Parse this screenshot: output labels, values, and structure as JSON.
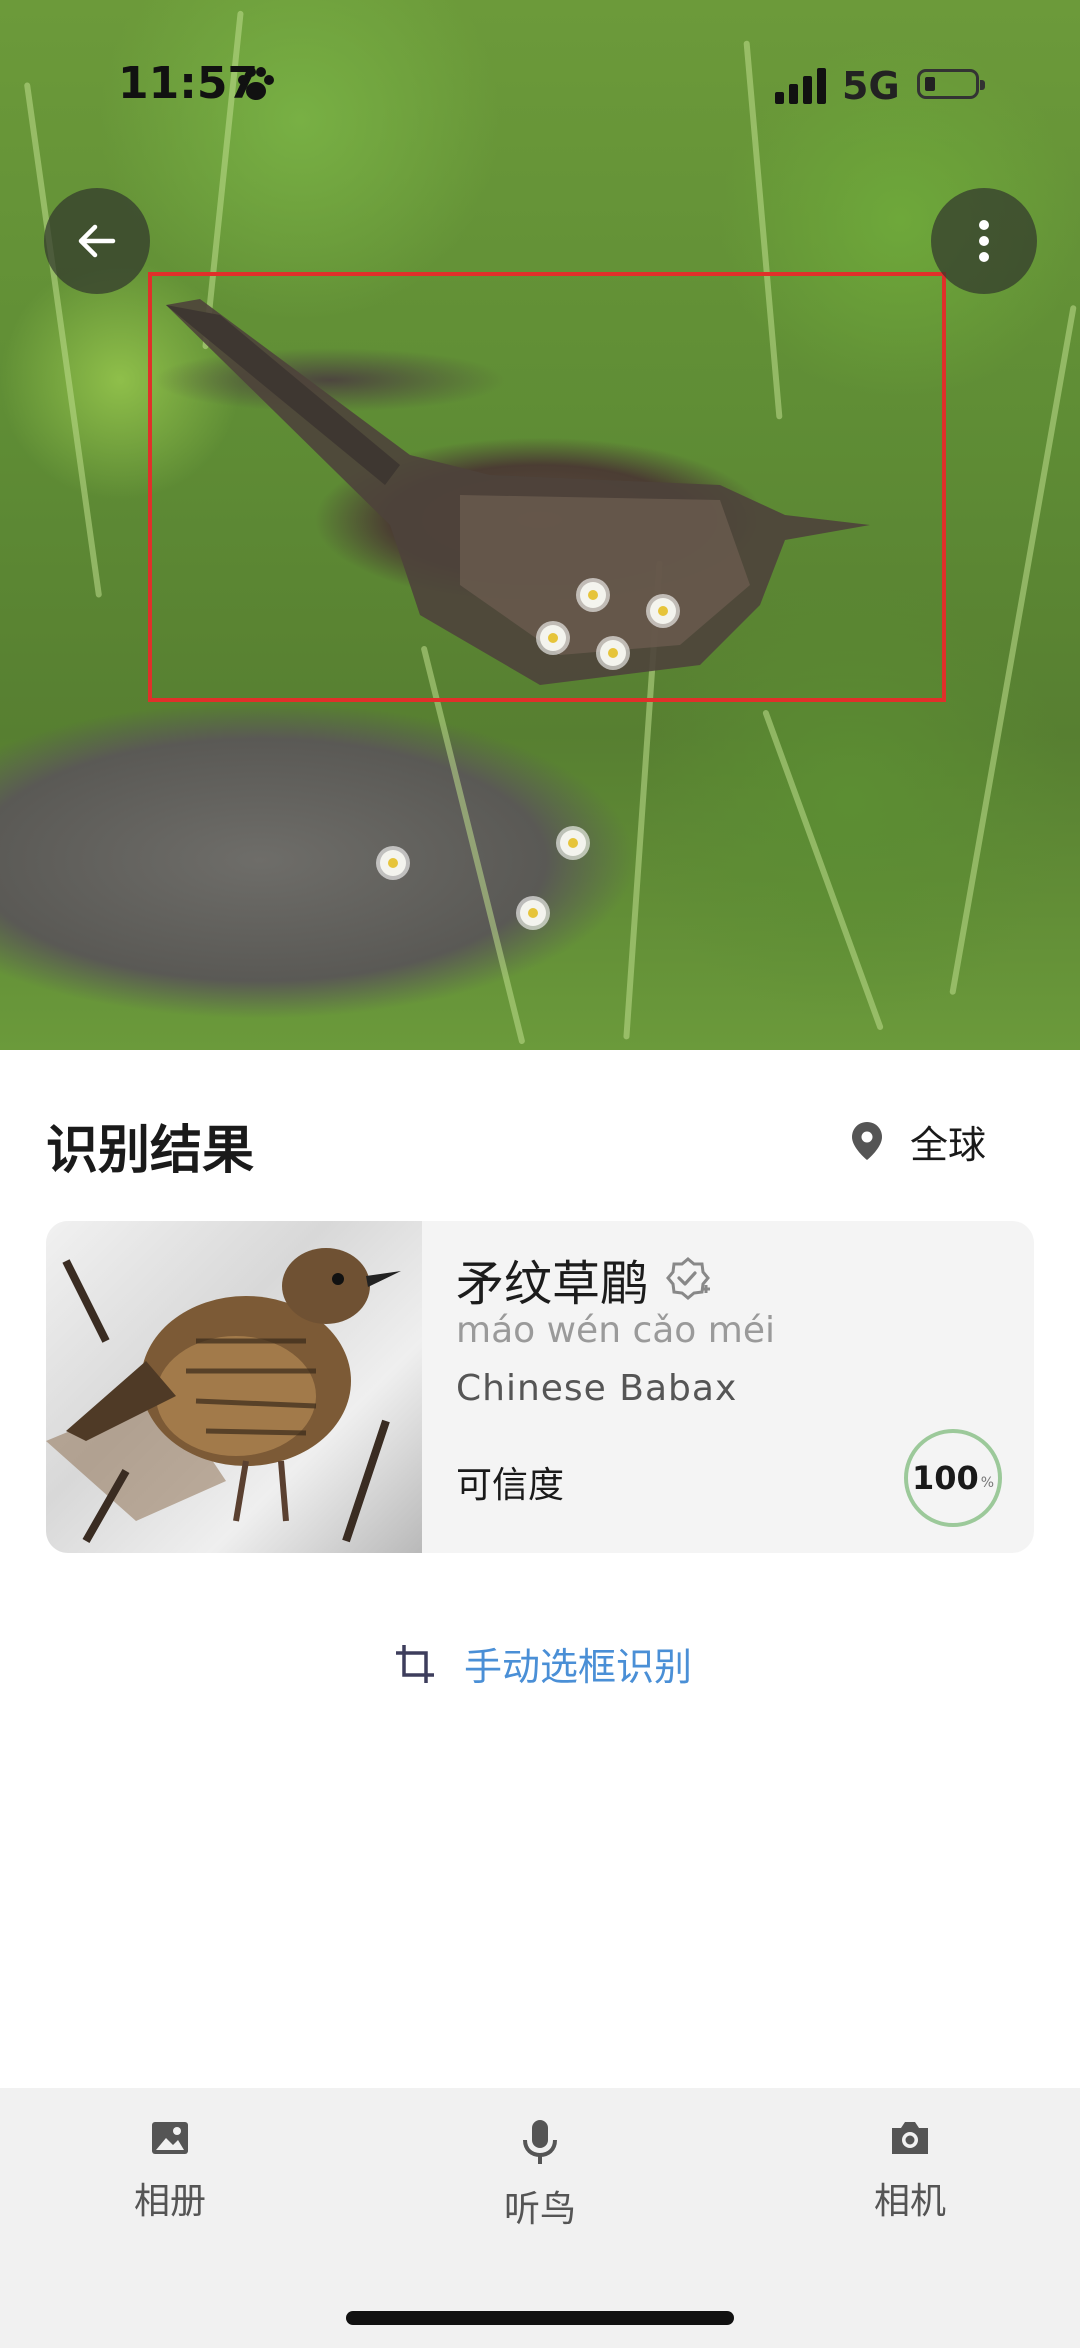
{
  "status_bar": {
    "time": "11:57",
    "network": "5G"
  },
  "detection": {
    "box_color": "#e0302a"
  },
  "result": {
    "title": "识别结果",
    "region_label": "全球",
    "species": {
      "name": "矛纹草鹛",
      "pinyin": "máo wén cǎo méi",
      "english_name": "Chinese Babax",
      "confidence_label": "可信度",
      "confidence_value": "100",
      "confidence_unit": "%"
    },
    "manual_select_label": "手动选框识别"
  },
  "bottom_nav": {
    "album": "相册",
    "listen": "听鸟",
    "camera": "相机"
  },
  "colors": {
    "accent_link": "#4a8fd6",
    "confidence_ring": "#9cc99a",
    "bottom_bar": "#f1f1f1"
  },
  "icons": [
    "arrow-left-icon",
    "more-vertical-icon",
    "location-pin-icon",
    "verified-plus-icon",
    "crop-icon",
    "image-icon",
    "microphone-icon",
    "camera-icon",
    "paw-icon",
    "signal-icon",
    "battery-icon"
  ]
}
